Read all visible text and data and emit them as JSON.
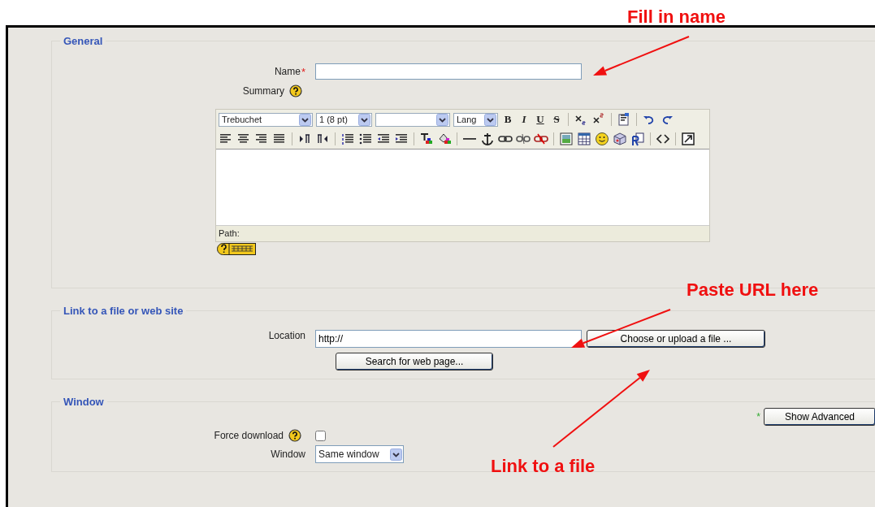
{
  "annotations": [
    {
      "text": "Fill in name"
    },
    {
      "text": "Paste URL here"
    },
    {
      "text": "Link to a file"
    }
  ],
  "general": {
    "legend": "General",
    "name_label": "Name",
    "required_mark": "*",
    "summary_label": "Summary",
    "editor": {
      "font_select": "Trebuchet",
      "size_select": "1 (8 pt)",
      "lang_select": "Lang",
      "format_buttons": [
        "B",
        "I",
        "U",
        "S"
      ],
      "path_label": "Path:"
    }
  },
  "link": {
    "legend": "Link to a file or web site",
    "location_label": "Location",
    "location_value": "http://",
    "choose_button": "Choose or upload a file ...",
    "search_button": "Search for web page..."
  },
  "window": {
    "legend": "Window",
    "advanced_mark": "*",
    "show_advanced_button": "Show Advanced",
    "force_download_label": "Force download",
    "force_download_checked": false,
    "window_label": "Window",
    "window_select": "Same window"
  }
}
